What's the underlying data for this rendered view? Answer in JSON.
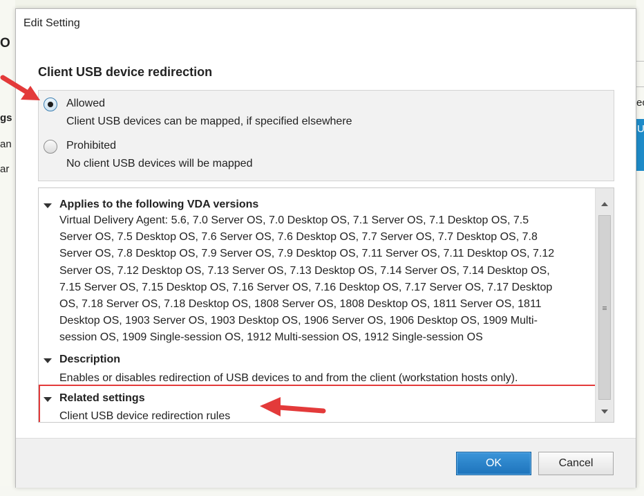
{
  "background": {
    "left_fragments": [
      "O",
      "gs",
      "an",
      "ar"
    ],
    "right_fragments": [
      "ec",
      "U"
    ]
  },
  "dialog": {
    "title": "Edit Setting",
    "setting_name": "Client USB device redirection",
    "options": [
      {
        "label": "Allowed",
        "description": "Client USB devices can be mapped, if specified elsewhere",
        "selected": true
      },
      {
        "label": "Prohibited",
        "description": "No client USB devices will be mapped",
        "selected": false
      }
    ],
    "details": {
      "vda": {
        "heading": "Applies to the following VDA versions",
        "lines": [
          "Virtual Delivery Agent: 5.6, 7.0 Server OS, 7.0 Desktop OS, 7.1 Server OS, 7.1 Desktop OS, 7.5",
          "Server OS, 7.5 Desktop OS, 7.6 Server OS, 7.6 Desktop OS, 7.7 Server OS, 7.7 Desktop OS, 7.8",
          "Server OS, 7.8 Desktop OS, 7.9 Server OS, 7.9 Desktop OS, 7.11 Server OS, 7.11 Desktop OS, 7.12",
          "Server OS, 7.12 Desktop OS, 7.13 Server OS, 7.13 Desktop OS, 7.14 Server OS, 7.14 Desktop OS,",
          "7.15 Server OS, 7.15 Desktop OS, 7.16 Server OS, 7.16 Desktop OS, 7.17 Server OS, 7.17 Desktop",
          "OS, 7.18 Server OS, 7.18 Desktop OS, 1808 Server OS, 1808 Desktop OS, 1811 Server OS, 1811",
          "Desktop OS, 1903 Server OS, 1903 Desktop OS, 1906 Server OS, 1906 Desktop OS, 1909 Multi-",
          "session OS, 1909 Single-session OS, 1912 Multi-session OS, 1912 Single-session OS"
        ]
      },
      "description": {
        "heading": "Description",
        "text": "Enables or disables redirection of USB devices to and from the client (workstation hosts only)."
      },
      "related": {
        "heading": "Related settings",
        "link": "Client USB device redirection rules"
      }
    },
    "buttons": {
      "ok": "OK",
      "cancel": "Cancel"
    }
  },
  "colors": {
    "highlight": "#e33a3a",
    "ok_button": "#1d73bb"
  }
}
